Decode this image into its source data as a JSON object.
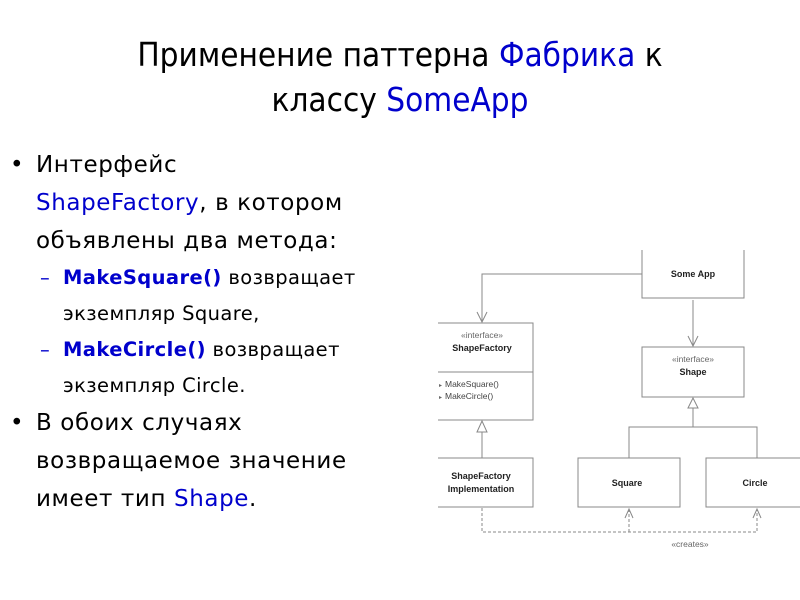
{
  "slide": {
    "title": {
      "part1": "Применение паттерна ",
      "accent1": "Фабрика",
      "part2": " к",
      "part3": "классу ",
      "accent2": "SomeApp"
    },
    "bullets": [
      {
        "line1": "Интерфейс",
        "accent": "ShapeFactory",
        "line2_rest": ", в котором",
        "line3": "объявлены два метода:"
      },
      {
        "line1": "В обоих случаях",
        "line2": "возвращаемое значение",
        "line3_prefix": "имеет тип ",
        "accent": "Shape",
        "line3_suffix": "."
      }
    ],
    "subbullets": [
      {
        "method": "MakeSquare()",
        "rest": " возвращает",
        "line2": "экземпляр Square,"
      },
      {
        "method": "MakeCircle()",
        "rest": " возвращает",
        "line2": "экземпляр Circle."
      }
    ],
    "colors": {
      "accent": "#0000cc",
      "text": "#000000",
      "diagram_line": "#888888"
    }
  },
  "diagram": {
    "someapp": {
      "name": "Some App"
    },
    "shapefactory": {
      "stereotype": "«interface»",
      "name": "ShapeFactory",
      "ops": [
        "MakeSquare()",
        "MakeCircle()"
      ]
    },
    "shape": {
      "stereotype": "«interface»",
      "name": "Shape"
    },
    "impl": {
      "line1": "ShapeFactory",
      "line2": "Implementation"
    },
    "square": {
      "name": "Square"
    },
    "circle": {
      "name": "Circle"
    },
    "creates_label": "«creates»"
  }
}
